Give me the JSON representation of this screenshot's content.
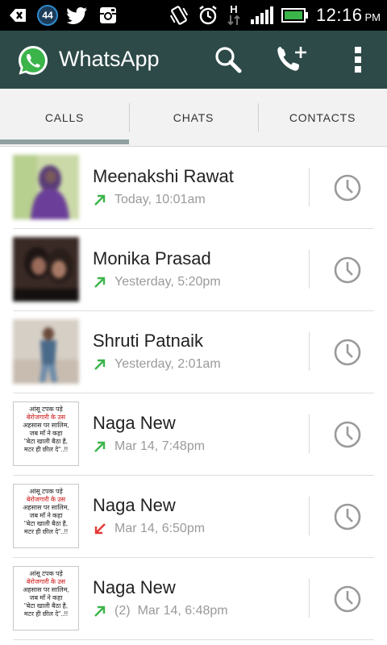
{
  "status_bar": {
    "notification_count": "44",
    "time": "12:16",
    "ampm": "PM",
    "network_label": "H"
  },
  "app_bar": {
    "title": "WhatsApp"
  },
  "tabs": [
    {
      "label": "CALLS",
      "selected": true
    },
    {
      "label": "CHATS",
      "selected": false
    },
    {
      "label": "CONTACTS",
      "selected": false
    }
  ],
  "calls": [
    {
      "name": "Meenakshi Rawat",
      "count": "",
      "time": "Today, 10:01am",
      "direction": "outgoing",
      "avatar": "photo-purple"
    },
    {
      "name": "Monika Prasad",
      "count": "",
      "time": "Yesterday, 5:20pm",
      "direction": "outgoing",
      "avatar": "photo-dark"
    },
    {
      "name": "Shruti Patnaik",
      "count": "",
      "time": "Yesterday, 2:01am",
      "direction": "outgoing",
      "avatar": "photo-light"
    },
    {
      "name": "Naga New",
      "count": "",
      "time": "Mar 14, 7:48pm",
      "direction": "outgoing",
      "avatar": "poster"
    },
    {
      "name": "Naga New",
      "count": "",
      "time": "Mar 14, 6:50pm",
      "direction": "missed",
      "avatar": "poster"
    },
    {
      "name": "Naga New",
      "count": "(2)",
      "time": "Mar 14, 6:48pm",
      "direction": "outgoing",
      "avatar": "poster"
    }
  ],
  "poster_text": {
    "line1": "आंसू टपक पड़े",
    "line2": "बेरोजगारी के उस",
    "line3": "अहसास पर सालिम,",
    "line4": "जब माँ ने कहा",
    "line5": "\"बेटा खाली बैठा है,",
    "line6": "मटर ही छील दे\"..!!"
  },
  "colors": {
    "app_bar": "#2d4a48",
    "outgoing_arrow": "#3bb44a",
    "missed_arrow": "#e53935",
    "tab_indicator": "#8fa0a0"
  },
  "icons": {
    "search": "search-icon",
    "new_call": "new-call-icon",
    "overflow": "overflow-menu-icon",
    "call_history": "clock-icon"
  }
}
